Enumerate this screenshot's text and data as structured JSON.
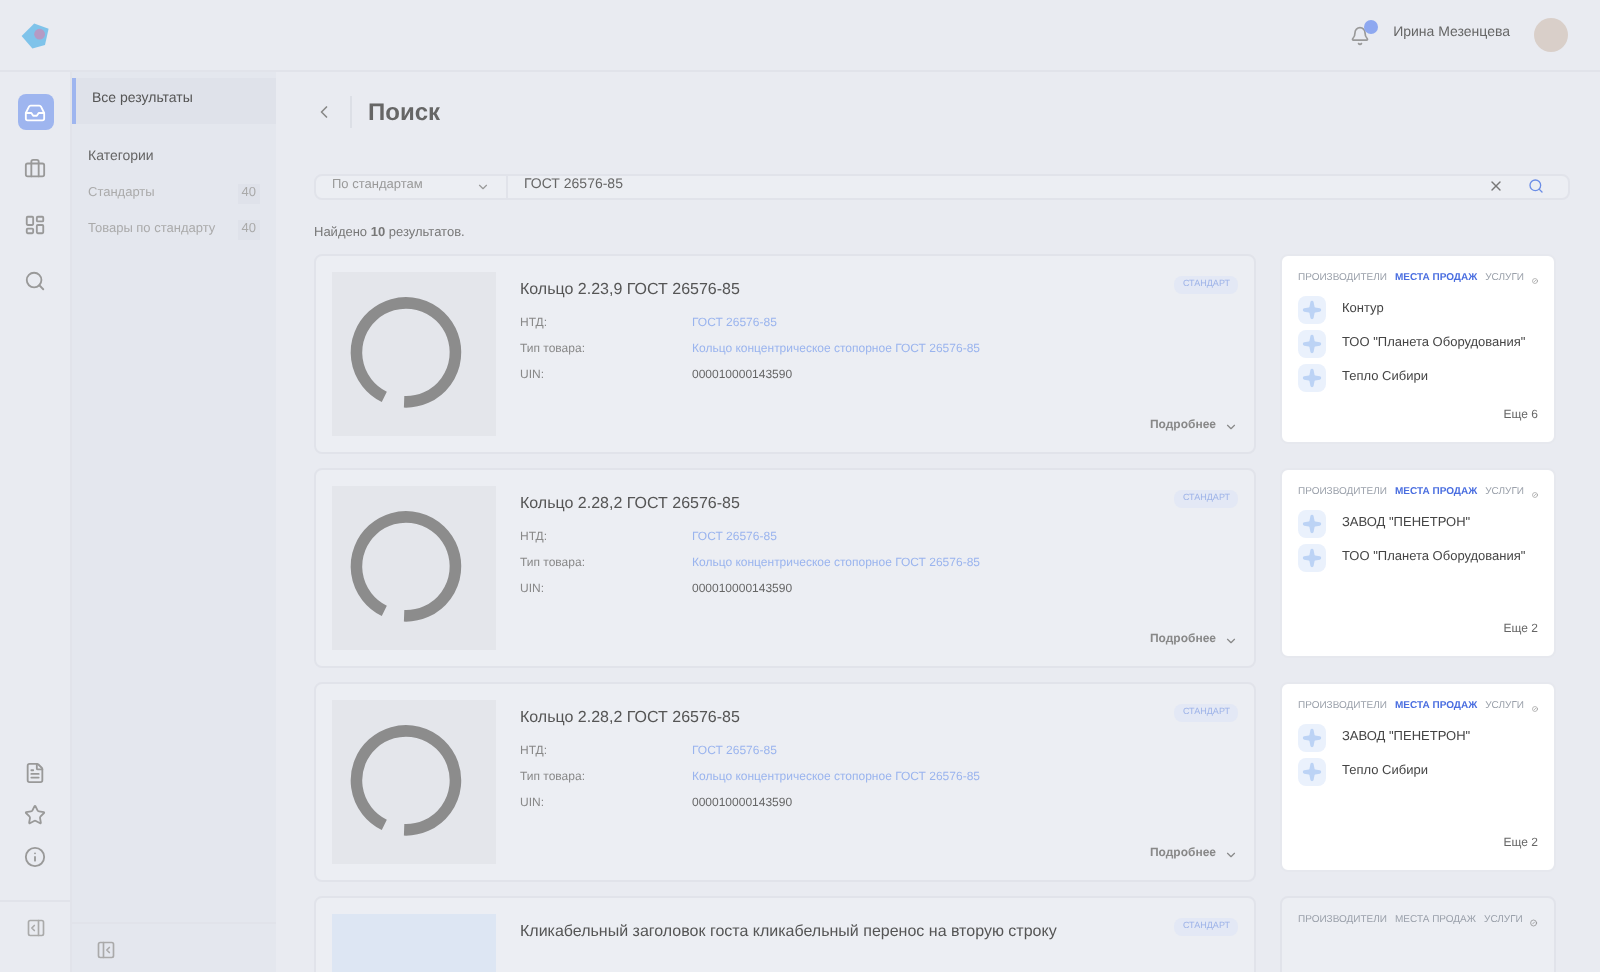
{
  "header": {
    "user_name": "Ирина Мезенцева"
  },
  "rail": {
    "items": [
      {
        "selected": true
      },
      {
        "selected": false
      },
      {
        "selected": false
      },
      {
        "selected": false
      }
    ]
  },
  "sidebar": {
    "all_results": {
      "label": "Все результаты",
      "selected": true
    },
    "categories_title": "Категории",
    "categories": [
      {
        "label": "Стандарты",
        "count": "40",
        "selected": false
      },
      {
        "label": "Товары по стандарту",
        "count": "40",
        "selected": false
      }
    ]
  },
  "page_title": "Поиск",
  "search": {
    "filter": "По стандартам",
    "value": "ГОСТ 26576-85"
  },
  "results_summary": "Найдено **10** результатов.",
  "results": [
    {
      "title": "Кольцо 2.23,9 ГОСТ 26576-85",
      "badge": "СТАНДАРТ",
      "kind": "ring",
      "fields": [
        {
          "label": "НТД:",
          "value": "ГОСТ 26576-85",
          "kind": "link"
        },
        {
          "label": "Тип товара:",
          "value": "Кольцо концентрическое стопорное ГОСТ 26576-85",
          "kind": "link"
        },
        {
          "label": "UIN:",
          "value": "000010000143590",
          "kind": "text"
        }
      ],
      "more": "Подробнее",
      "panel": {
        "highlighted": true,
        "tabs": [
          {
            "label": "ПРОИЗВОДИТЕЛИ",
            "selected": false
          },
          {
            "label": "МЕСТА ПРОДАЖ",
            "selected": true
          },
          {
            "label": "УСЛУГИ",
            "selected": false
          }
        ],
        "items": [
          "Контур",
          "ТОО \"Планета Оборудования\"",
          "Тепло Сибири"
        ],
        "more": "Еще 6"
      }
    },
    {
      "title": "Кольцо 2.28,2 ГОСТ 26576-85",
      "badge": "СТАНДАРТ",
      "kind": "ring",
      "fields": [
        {
          "label": "НТД:",
          "value": "ГОСТ 26576-85",
          "kind": "link"
        },
        {
          "label": "Тип товара:",
          "value": "Кольцо концентрическое стопорное ГОСТ 26576-85",
          "kind": "link"
        },
        {
          "label": "UIN:",
          "value": "000010000143590",
          "kind": "text"
        }
      ],
      "more": "Подробнее",
      "panel": {
        "highlighted": true,
        "tabs": [
          {
            "label": "ПРОИЗВОДИТЕЛИ",
            "selected": false
          },
          {
            "label": "МЕСТА ПРОДАЖ",
            "selected": true
          },
          {
            "label": "УСЛУГИ",
            "selected": false
          }
        ],
        "items": [
          "ЗАВОД \"ПЕНЕТРОН\"",
          "ТОО \"Планета Оборудования\""
        ],
        "more": "Еще 2"
      }
    },
    {
      "title": "Кольцо 2.28,2 ГОСТ 26576-85",
      "badge": "СТАНДАРТ",
      "kind": "ring",
      "fields": [
        {
          "label": "НТД:",
          "value": "ГОСТ 26576-85",
          "kind": "link"
        },
        {
          "label": "Тип товара:",
          "value": "Кольцо концентрическое стопорное ГОСТ 26576-85",
          "kind": "link"
        },
        {
          "label": "UIN:",
          "value": "000010000143590",
          "kind": "text"
        }
      ],
      "more": "Подробнее",
      "panel": {
        "highlighted": true,
        "tabs": [
          {
            "label": "ПРОИЗВОДИТЕЛИ",
            "selected": false
          },
          {
            "label": "МЕСТА ПРОДАЖ",
            "selected": true
          },
          {
            "label": "УСЛУГИ",
            "selected": false
          }
        ],
        "items": [
          "ЗАВОД \"ПЕНЕТРОН\"",
          "Тепло Сибири"
        ],
        "more": "Еще 2"
      }
    },
    {
      "title": "Кликабельный заголовок госта кликабельный перенос на вторую строку",
      "badge": "СТАНДАРТ",
      "kind": "plain",
      "panel": {
        "highlighted": false,
        "tabs": [
          {
            "label": "ПРОИЗВОДИТЕЛИ",
            "selected": false
          },
          {
            "label": "МЕСТА ПРОДАЖ",
            "selected": false
          },
          {
            "label": "УСЛУГИ",
            "selected": false
          }
        ]
      }
    }
  ]
}
